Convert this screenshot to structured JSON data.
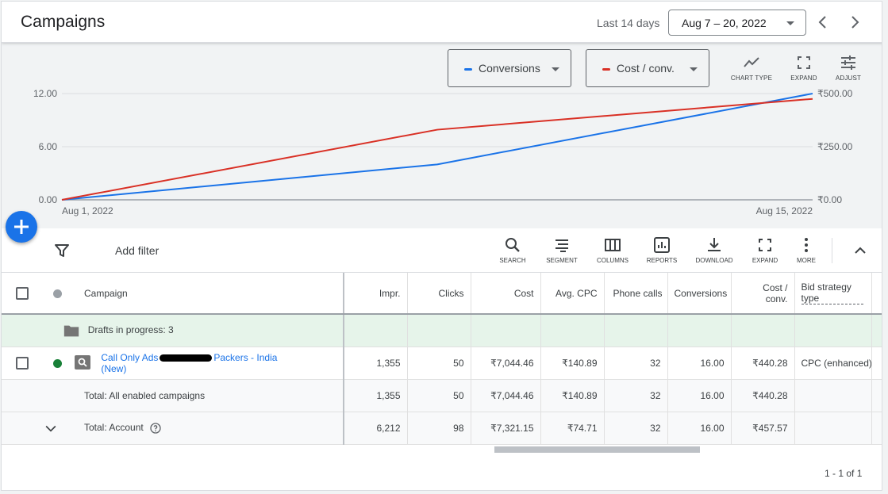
{
  "header": {
    "title": "Campaigns",
    "date_label": "Last 14 days",
    "date_range": "Aug 7 – 20, 2022"
  },
  "chart_controls": {
    "metric1": {
      "label": "Conversions",
      "color": "#1a73e8"
    },
    "metric2": {
      "label": "Cost / conv.",
      "color": "#d93025"
    },
    "chart_type": "CHART TYPE",
    "expand": "EXPAND",
    "adjust": "ADJUST"
  },
  "chart_data": {
    "type": "line",
    "x": [
      "Aug 1, 2022",
      "Aug 8, 2022",
      "Aug 15, 2022"
    ],
    "x_tick_labels": [
      "Aug 1, 2022",
      "Aug 15, 2022"
    ],
    "series": [
      {
        "name": "Conversions",
        "axis": "left",
        "color": "#1a73e8",
        "values": [
          0,
          4,
          12
        ]
      },
      {
        "name": "Cost / conv.",
        "axis": "right",
        "color": "#d93025",
        "values": [
          0,
          330,
          475
        ]
      }
    ],
    "y_left": {
      "ticks": [
        "0.00",
        "6.00",
        "12.00"
      ],
      "lim": [
        0,
        12
      ]
    },
    "y_right": {
      "ticks": [
        "₹0.00",
        "₹250.00",
        "₹500.00"
      ],
      "lim": [
        0,
        500
      ]
    },
    "grid": true
  },
  "toolbar": {
    "add_filter": "Add filter",
    "tools": [
      "SEARCH",
      "SEGMENT",
      "COLUMNS",
      "REPORTS",
      "DOWNLOAD",
      "EXPAND",
      "MORE"
    ]
  },
  "table": {
    "headers": {
      "campaign": "Campaign",
      "impr": "Impr.",
      "clicks": "Clicks",
      "cost": "Cost",
      "avg_cpc": "Avg. CPC",
      "phone_calls": "Phone calls",
      "conversions": "Conversions",
      "cost_conv_1": "Cost /",
      "cost_conv_2": "conv.",
      "bid_1": "Bid strategy",
      "bid_2": "type"
    },
    "drafts": "Drafts in progress: 3",
    "campaign_row": {
      "name_part1": "Call Only Ads",
      "name_part2": "Packers - India",
      "name_part3": "(New)",
      "impr": "1,355",
      "clicks": "50",
      "cost": "₹7,044.46",
      "avg_cpc": "₹140.89",
      "phone_calls": "32",
      "conversions": "16.00",
      "cost_conv": "₹440.28",
      "bid": "CPC (enhanced)"
    },
    "total_enabled": {
      "label": "Total: All enabled campaigns",
      "impr": "1,355",
      "clicks": "50",
      "cost": "₹7,044.46",
      "avg_cpc": "₹140.89",
      "phone_calls": "32",
      "conversions": "16.00",
      "cost_conv": "₹440.28"
    },
    "total_account": {
      "label": "Total: Account",
      "impr": "6,212",
      "clicks": "98",
      "cost": "₹7,321.15",
      "avg_cpc": "₹74.71",
      "phone_calls": "32",
      "conversions": "16.00",
      "cost_conv": "₹457.57"
    }
  },
  "pagination": "1 - 1 of 1"
}
